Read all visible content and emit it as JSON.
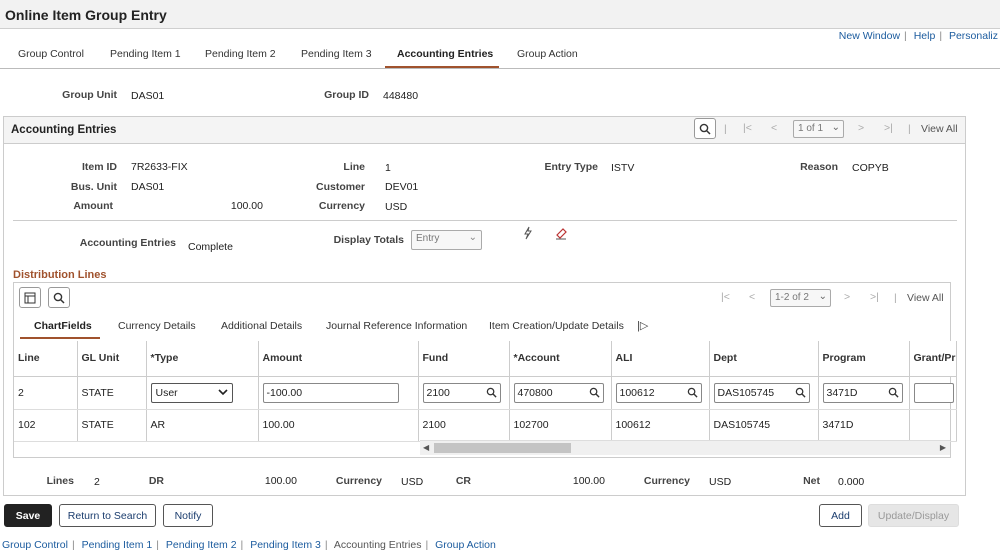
{
  "page_title": "Online Item Group Entry",
  "top_links": [
    "New Window",
    "Help",
    "Personaliz"
  ],
  "tabs": [
    {
      "label": "Group Control",
      "key": "G"
    },
    {
      "label": "Pending Item 1",
      "key": "P"
    },
    {
      "label": "Pending Item 2",
      "key": "e"
    },
    {
      "label": "Pending Item 3",
      "key": "I"
    },
    {
      "label": "Accounting Entries",
      "key": ""
    },
    {
      "label": "Group Action",
      "key": "A"
    }
  ],
  "header": {
    "group_unit_label": "Group Unit",
    "group_unit": "DAS01",
    "group_id_label": "Group ID",
    "group_id": "448480"
  },
  "accounting": {
    "title": "Accounting Entries",
    "pager": "1 of 1",
    "view_all": "View All",
    "item_id_label": "Item ID",
    "item_id": "7R2633-FIX",
    "line_label": "Line",
    "line": "1",
    "entry_type_label": "Entry Type",
    "entry_type": "ISTV",
    "reason_label": "Reason",
    "reason": "COPYB",
    "bus_unit_label": "Bus. Unit",
    "bus_unit": "DAS01",
    "customer_label": "Customer",
    "customer": "DEV01",
    "amount_label": "Amount",
    "amount": "100.00",
    "currency_label": "Currency",
    "currency": "USD",
    "entries_label": "Accounting Entries",
    "entries_status": "Complete",
    "display_totals_label": "Display Totals",
    "display_totals": "Entry"
  },
  "distribution": {
    "title": "Distribution Lines",
    "pager": "1-2 of 2",
    "view_all": "View All",
    "subtabs": [
      "ChartFields",
      "Currency Details",
      "Additional Details",
      "Journal Reference Information",
      "Item Creation/Update Details"
    ],
    "columns": [
      "Line",
      "GL Unit",
      "*Type",
      "Amount",
      "Fund",
      "*Account",
      "ALI",
      "Dept",
      "Program",
      "Grant/Pr"
    ],
    "row1": {
      "line": "2",
      "gl_unit": "STATE",
      "type": "User",
      "amount": "-100.00",
      "fund": "2100",
      "account": "470800",
      "ali": "100612",
      "dept": "DAS105745",
      "program": "3471D"
    },
    "row2": {
      "line": "102",
      "gl_unit": "STATE",
      "type": "AR",
      "amount": "100.00",
      "fund": "2100",
      "account": "102700",
      "ali": "100612",
      "dept": "DAS105745",
      "program": "3471D"
    }
  },
  "totals": {
    "lines_label": "Lines",
    "lines": "2",
    "dr_label": "DR",
    "dr": "100.00",
    "currency_label": "Currency",
    "currency_dr": "USD",
    "cr_label": "CR",
    "cr": "100.00",
    "currency_cr": "USD",
    "net_label": "Net",
    "net": "0.000"
  },
  "buttons": {
    "save": "Save",
    "return": "Return to Search",
    "notify": "Notify",
    "add": "Add",
    "update_display": "Update/Display"
  },
  "bottom_links": [
    "Group Control",
    "Pending Item 1",
    "Pending Item 2",
    "Pending Item 3",
    "Accounting Entries",
    "Group Action"
  ],
  "colors": {
    "accent": "#a0522d",
    "link": "#1b5b9e"
  }
}
